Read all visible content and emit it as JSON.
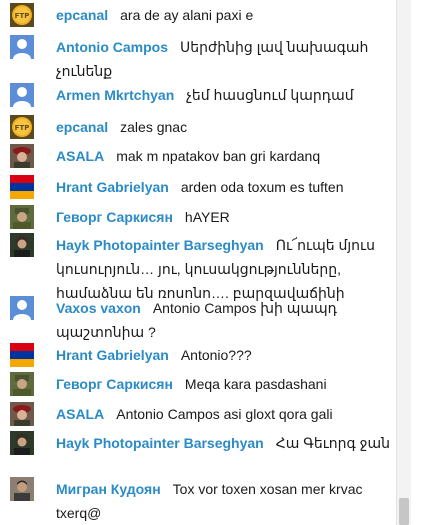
{
  "messages": [
    {
      "author": "epcanal",
      "text": "ara de ay alani paxi e",
      "avatar": "ftp-logo-icon"
    },
    {
      "author": "Antonio Campos",
      "text": "Սերժինից լավ նախագահ չունենք",
      "avatar": "default-user-icon"
    },
    {
      "author": "Armen Mkrtchyan",
      "text": "չեմ հասցնում կարդամ",
      "avatar": "default-user-icon"
    },
    {
      "author": "epcanal",
      "text": "zales gnac",
      "avatar": "ftp-logo-icon"
    },
    {
      "author": "ASALA",
      "text": "mak m npatakov ban gri kardanq",
      "avatar": "photo-beret-icon"
    },
    {
      "author": "Hrant Gabrielyan",
      "text": "arden oda toxum es tuften",
      "avatar": "armenian-flag-icon"
    },
    {
      "author": "Геворг Саркисян",
      "text": "hAYER",
      "avatar": "photo-soldier-icon"
    },
    {
      "author": "Hayk Photopainter Barseghyan",
      "text": "Ու՜ուպե մյուս կուսուրյուն… յու, կուսակցությունները, համաձնա են ռոսոնո…. բարզավաճինի",
      "avatar": "photo-portrait-icon"
    },
    {
      "author": "Vaxos vaxon",
      "text": "Antonio Campos խի պապդ պաշտոնիա ?",
      "avatar": "default-user-icon"
    },
    {
      "author": "Hrant Gabrielyan",
      "text": "Antonio???",
      "avatar": "armenian-flag-icon"
    },
    {
      "author": "Геворг Саркисян",
      "text": "Meqa kara pasdashani",
      "avatar": "photo-soldier-icon"
    },
    {
      "author": "ASALA",
      "text": "Antonio Campos asi gloxt qora gali",
      "avatar": "photo-beret-icon"
    },
    {
      "author": "Hayk Photopainter Barseghyan",
      "text": "Հա Գեւորգ ջան",
      "avatar": "photo-portrait-icon"
    },
    {
      "author": "Мигран Кудоян",
      "text": "Tox vor toxen xosan mer krvac txerq@",
      "avatar": "photo-man-icon"
    }
  ],
  "colors": {
    "author": "#2b8bc6",
    "default_avatar": "#5b8ed6",
    "ftp_logo": "#f2b01e"
  }
}
